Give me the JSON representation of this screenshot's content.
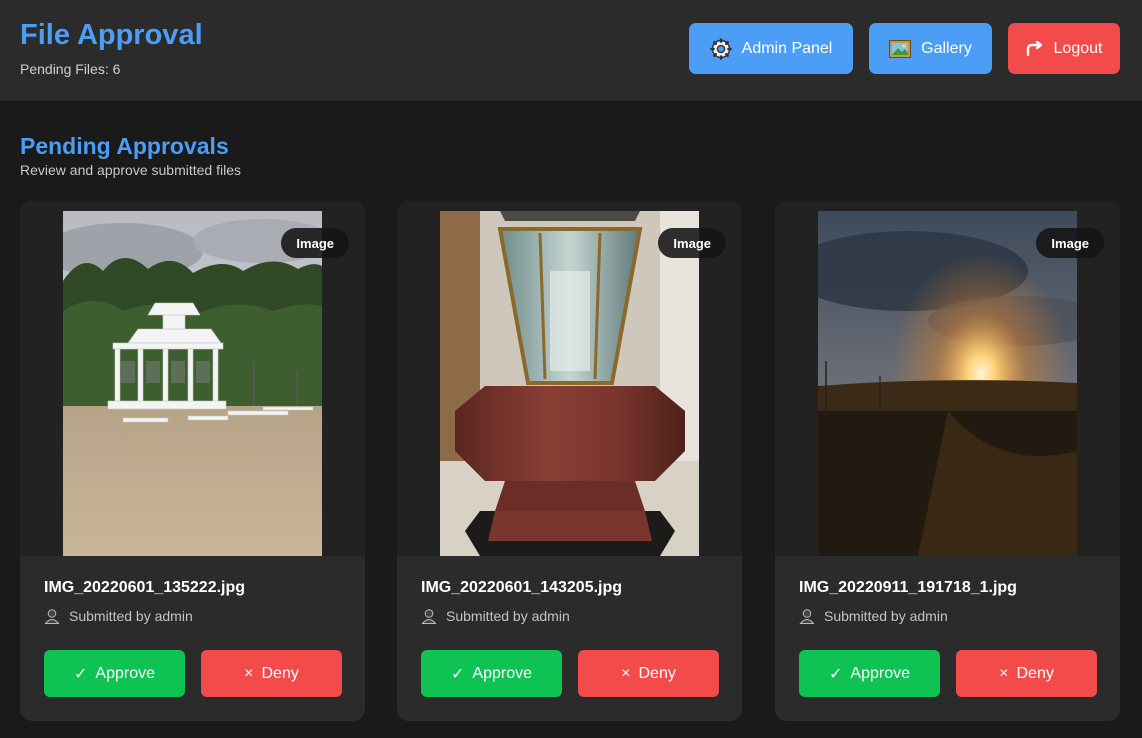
{
  "header": {
    "title": "File Approval",
    "pending": "Pending Files: 6",
    "buttons": {
      "admin": "Admin Panel",
      "gallery": "Gallery",
      "logout": "Logout"
    }
  },
  "section": {
    "title": "Pending Approvals",
    "subtitle": "Review and approve submitted files"
  },
  "cards": [
    {
      "badge": "Image",
      "filename": "IMG_20220601_135222.jpg",
      "submitted": "Submitted by admin",
      "approve": "Approve",
      "deny": "Deny",
      "scene": "white gazebo in park"
    },
    {
      "badge": "Image",
      "filename": "IMG_20220601_143205.jpg",
      "submitted": "Submitted by admin",
      "approve": "Approve",
      "deny": "Deny",
      "scene": "glass fountain on granite base"
    },
    {
      "badge": "Image",
      "filename": "IMG_20220911_191718_1.jpg",
      "submitted": "Submitted by admin",
      "approve": "Approve",
      "deny": "Deny",
      "scene": "sunset over field"
    }
  ],
  "glyphs": {
    "approve": "✓",
    "deny": "×"
  },
  "icons": {
    "admin": "gear-icon",
    "gallery": "picture-icon",
    "logout": "logout-arrow-icon",
    "user": "user-icon"
  },
  "colors": {
    "accent": "#4b9df5",
    "approve": "#0ec254",
    "deny": "#f34a4a",
    "background": "#1a1a1a",
    "surface": "#2b2b2b"
  }
}
